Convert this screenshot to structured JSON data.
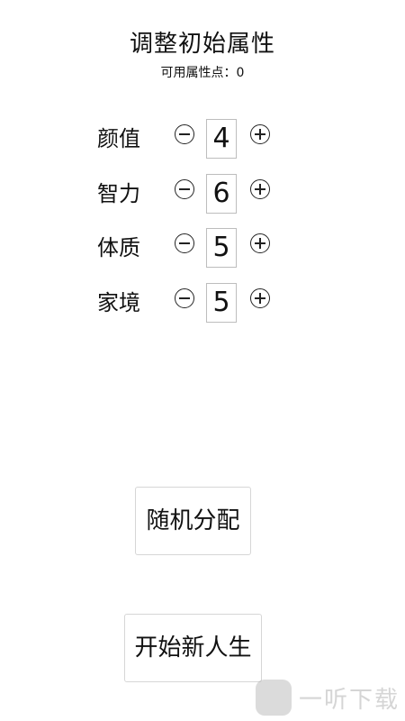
{
  "header": {
    "title": "调整初始属性",
    "points_label": "可用属性点：0"
  },
  "attributes": [
    {
      "label": "颜值",
      "value": "4"
    },
    {
      "label": "智力",
      "value": "6"
    },
    {
      "label": "体质",
      "value": "5"
    },
    {
      "label": "家境",
      "value": "5"
    }
  ],
  "buttons": {
    "random": "随机分配",
    "start": "开始新人生"
  },
  "watermark": {
    "text": "一听下载"
  }
}
